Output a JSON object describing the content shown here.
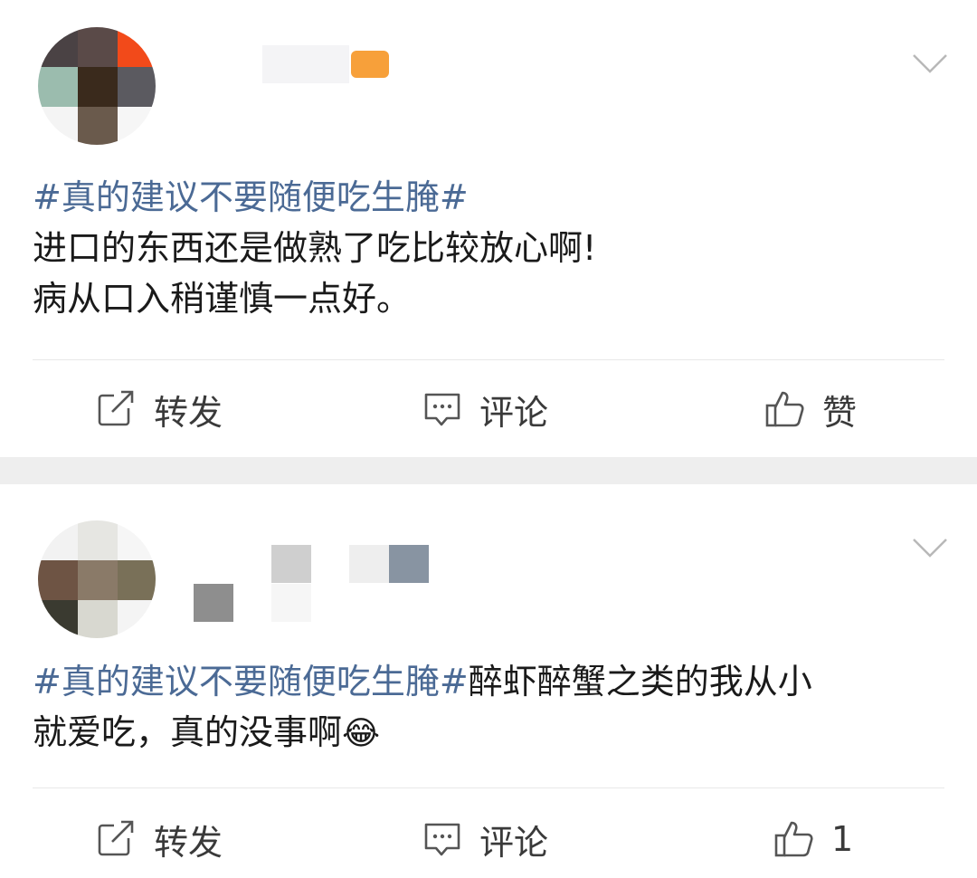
{
  "colors": {
    "hashtag": "#4b6a95",
    "separator": "#eeeeee",
    "icon": "#555555"
  },
  "posts": [
    {
      "hashtag": "#真的建议不要随便吃生腌#",
      "text_line1": "进口的东西还是做熟了吃比较放心啊!",
      "text_line2": "病从口入稍谨慎一点好。",
      "actions": {
        "repost": "转发",
        "comment": "评论",
        "like": "赞"
      }
    },
    {
      "hashtag": "#真的建议不要随便吃生腌#",
      "text_after_tag": "醉虾醉蟹之类的我从小",
      "text_line2": "就爱吃，真的没事啊",
      "emoji": "😂",
      "actions": {
        "repost": "转发",
        "comment": "评论",
        "like": "1"
      }
    }
  ],
  "icons": [
    "repost-icon",
    "comment-icon",
    "thumbs-up-icon",
    "chevron-down-icon",
    "emoji-laugh-cry"
  ]
}
